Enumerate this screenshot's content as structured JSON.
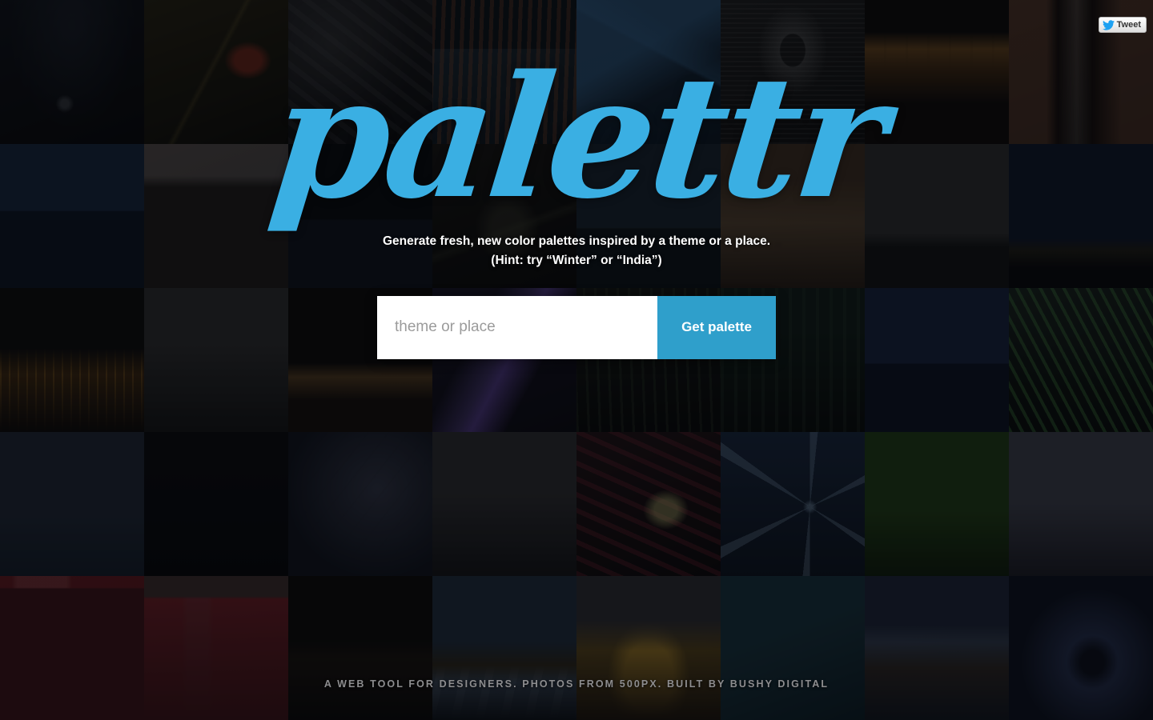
{
  "site": {
    "logo_text": "palettr",
    "logo_color": "#3aafe3"
  },
  "hero": {
    "tagline_line1": "Generate fresh, new color palettes inspired by a theme or a place.",
    "tagline_line2": "(Hint: try “Winter” or “India”)"
  },
  "search": {
    "placeholder": "theme or place",
    "value": "",
    "submit_label": "Get palette",
    "button_color": "#2f9fcb"
  },
  "footer": {
    "text": "A WEB TOOL FOR DESIGNERS. PHOTOS FROM 500PX. BUILT BY BUSHY DIGITAL"
  },
  "share": {
    "tweet_label": "Tweet",
    "icon": "twitter-bird-icon",
    "icon_color": "#1da1f2"
  },
  "background": {
    "columns": 8,
    "rows": 5,
    "cell_size": 180,
    "overlay": "rgba(6,7,11,0.55)",
    "tiles": [
      {
        "name": "night-sky-silhouette",
        "c1": "#0d1016",
        "c2": "#050507",
        "accent": "#2a3240",
        "motif": "haze"
      },
      {
        "name": "red-insect-on-stem",
        "c1": "#241f10",
        "c2": "#0b0a05",
        "accent": "#7a2618",
        "motif": "bug"
      },
      {
        "name": "dark-machinery",
        "c1": "#1a1a1c",
        "c2": "#0a0a0b",
        "accent": "#4a4a4e",
        "motif": "metal"
      },
      {
        "name": "coastal-town-rooftops",
        "c1": "#1d2a33",
        "c2": "#0a1016",
        "accent": "#8a4a28",
        "motif": "town"
      },
      {
        "name": "blue-iceberg",
        "c1": "#17293d",
        "c2": "#091520",
        "accent": "#2f5d86",
        "motif": "ice"
      },
      {
        "name": "couple-with-umbrella",
        "c1": "#1c1c1c",
        "c2": "#0c0c0c",
        "accent": "#6d6d6d",
        "motif": "bw"
      },
      {
        "name": "sunset-fence-field",
        "c1": "#2a1d12",
        "c2": "#0c0806",
        "accent": "#8a5a20",
        "motif": "sunset"
      },
      {
        "name": "stone-alleyway",
        "c1": "#251a14",
        "c2": "#0d0907",
        "accent": "#6b4430",
        "motif": "alley"
      },
      {
        "name": "moonlit-mountain-lake",
        "c1": "#111a2a",
        "c2": "#070b13",
        "accent": "#24344f",
        "motif": "lake"
      },
      {
        "name": "arctic-ice-floes",
        "c1": "#2a1b14",
        "c2": "#0b0b0d",
        "accent": "#8d8d90",
        "motif": "floes"
      },
      {
        "name": "moon-path-on-water",
        "c1": "#0c1119",
        "c2": "#050608",
        "accent": "#5c6a7c",
        "motif": "moonpath"
      },
      {
        "name": "dark-flower-stem",
        "c1": "#14120f",
        "c2": "#070706",
        "accent": "#3b3a2c",
        "motif": "flower"
      },
      {
        "name": "penguin-on-shore",
        "c1": "#16202b",
        "c2": "#080c11",
        "accent": "#3b4b5d",
        "motif": "shore"
      },
      {
        "name": "beach-footprints",
        "c1": "#2b2118",
        "c2": "#100c09",
        "accent": "#7a5f41",
        "motif": "sand"
      },
      {
        "name": "overcast-storm-clouds",
        "c1": "#1e1e1e",
        "c2": "#0b0b0b",
        "accent": "#4d4d4d",
        "motif": "clouds"
      },
      {
        "name": "milky-way-over-cliff",
        "c1": "#0e1422",
        "c2": "#05070c",
        "accent": "#2c3a56",
        "motif": "stars"
      },
      {
        "name": "city-lights-riverside",
        "c1": "#1a1208",
        "c2": "#0a0705",
        "accent": "#8a5418",
        "motif": "citynight"
      },
      {
        "name": "golden-gate-road-sign",
        "c1": "#191919",
        "c2": "#090909",
        "accent": "#6a6a6a",
        "motif": "sign"
      },
      {
        "name": "dawn-horizon-plain",
        "c1": "#1a1410",
        "c2": "#080706",
        "accent": "#6a4a24",
        "motif": "dawn"
      },
      {
        "name": "purple-light-streak",
        "c1": "#161324",
        "c2": "#08070e",
        "accent": "#4b3a7a",
        "motif": "streak"
      },
      {
        "name": "forest-canopy-dark",
        "c1": "#121410",
        "c2": "#070806",
        "accent": "#2f3a28",
        "motif": "forest"
      },
      {
        "name": "pine-trees-night",
        "c1": "#0f1410",
        "c2": "#060806",
        "accent": "#2a3a2c",
        "motif": "pines"
      },
      {
        "name": "city-skyline-blue",
        "c1": "#151d33",
        "c2": "#080b16",
        "accent": "#3a4a7a",
        "motif": "skyline"
      },
      {
        "name": "green-fern-fronds",
        "c1": "#16201a",
        "c2": "#080c09",
        "accent": "#3f7a3a",
        "motif": "fern"
      },
      {
        "name": "pelican-landing-water",
        "c1": "#1a222e",
        "c2": "#0a0e14",
        "accent": "#6e7886",
        "motif": "pelican"
      },
      {
        "name": "bridge-lights-night",
        "c1": "#0b0b0f",
        "c2": "#050507",
        "accent": "#2a3a8a",
        "motif": "bridge"
      },
      {
        "name": "bare-branches-mist",
        "c1": "#1c1f2c",
        "c2": "#0c0e14",
        "accent": "#3c4052",
        "motif": "branches"
      },
      {
        "name": "glass-tower-city",
        "c1": "#202022",
        "c2": "#0d0d0e",
        "accent": "#5e5e62",
        "motif": "tower"
      },
      {
        "name": "butterfly-on-red",
        "c1": "#1e1012",
        "c2": "#0a0607",
        "accent": "#7a2030",
        "motif": "butterfly"
      },
      {
        "name": "snowflake-macro",
        "c1": "#121e2e",
        "c2": "#070c14",
        "accent": "#4a6a8e",
        "motif": "snowflake"
      },
      {
        "name": "frog-shadow-on-leaf",
        "c1": "#16260f",
        "c2": "#0a1207",
        "accent": "#4f8f22",
        "motif": "leaf"
      },
      {
        "name": "pink-poppies-field",
        "c1": "#2a2430",
        "c2": "#121016",
        "accent": "#8a4a68",
        "motif": "poppies"
      },
      {
        "name": "old-red-bus-window",
        "c1": "#2a1012",
        "c2": "#120607",
        "accent": "#7a1a20",
        "motif": "bus"
      },
      {
        "name": "red-wall-window",
        "c1": "#2e1216",
        "c2": "#140709",
        "accent": "#8a2028",
        "motif": "redwall"
      },
      {
        "name": "desert-ridge-at-dusk",
        "c1": "#120e0a",
        "c2": "#070605",
        "accent": "#6a4a1c",
        "motif": "ridge"
      },
      {
        "name": "dramatic-sky-clouds",
        "c1": "#182230",
        "c2": "#0a0f16",
        "accent": "#5c6e84",
        "motif": "drama"
      },
      {
        "name": "golden-rock-pagoda",
        "c1": "#2c2214",
        "c2": "#120e08",
        "accent": "#a07a24",
        "motif": "pagoda"
      },
      {
        "name": "aerial-coast-map",
        "c1": "#122028",
        "c2": "#080f13",
        "accent": "#2f5a68",
        "motif": "aerial"
      },
      {
        "name": "snow-mountain-lagoon",
        "c1": "#1a2030",
        "c2": "#0a0d14",
        "accent": "#5a6a84",
        "motif": "lagoon"
      },
      {
        "name": "blue-ice-cave",
        "c1": "#131a2c",
        "c2": "#080b14",
        "accent": "#33406a",
        "motif": "cave"
      }
    ]
  }
}
